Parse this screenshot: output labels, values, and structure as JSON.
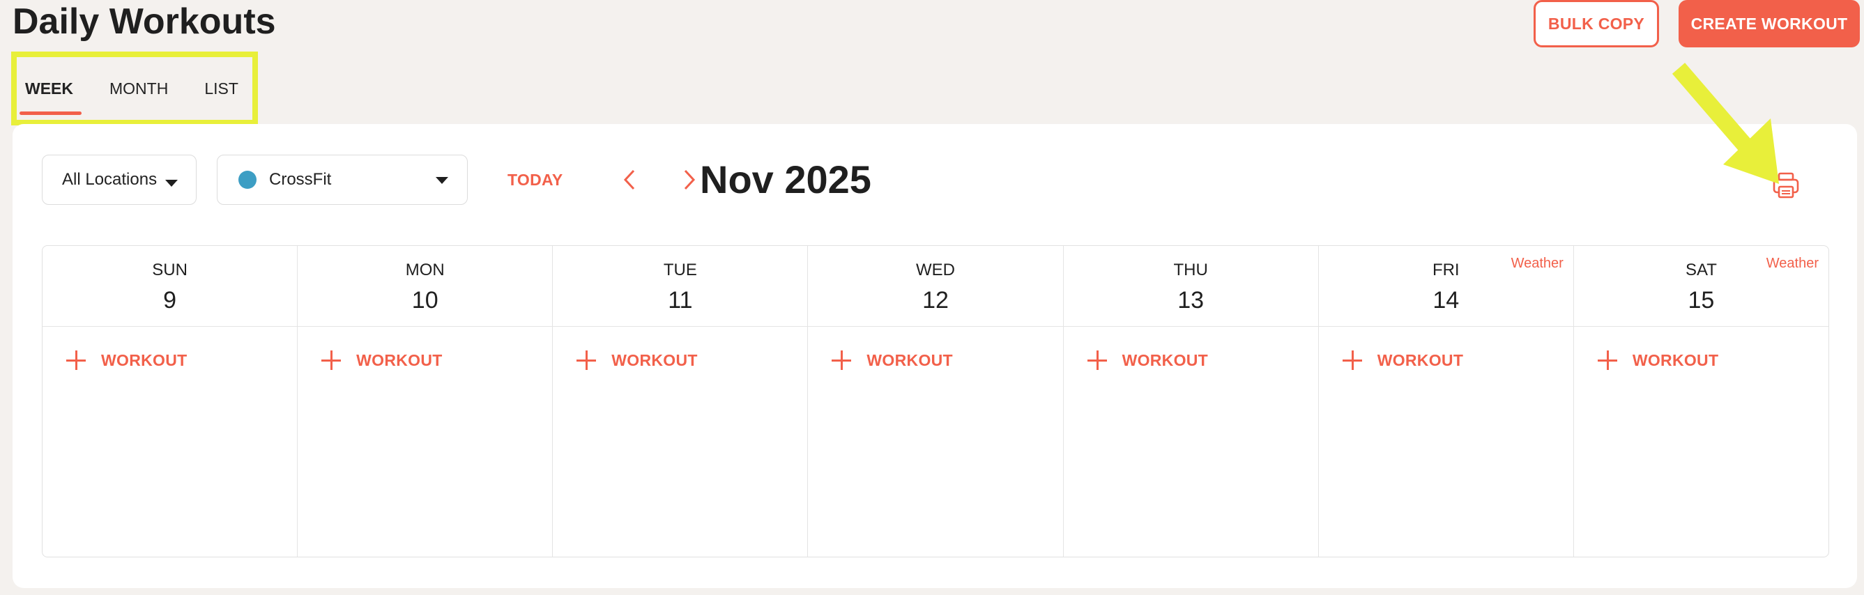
{
  "page": {
    "title": "Daily Workouts"
  },
  "header": {
    "bulk_copy_label": "BULK COPY",
    "create_workout_label": "CREATE WORKOUT"
  },
  "tabs": [
    {
      "label": "WEEK",
      "active": true
    },
    {
      "label": "MONTH",
      "active": false
    },
    {
      "label": "LIST",
      "active": false
    }
  ],
  "toolbar": {
    "location_select": "All Locations",
    "program_select": "CrossFit",
    "program_color": "#3d9ec4",
    "today_label": "TODAY",
    "prev_icon": "chevron-left-icon",
    "next_icon": "chevron-right-icon",
    "month_label": "Nov 2025",
    "print_icon": "printer-icon"
  },
  "calendar": {
    "days": [
      {
        "dow": "SUN",
        "date": "9",
        "weather": "",
        "add_label": "WORKOUT"
      },
      {
        "dow": "MON",
        "date": "10",
        "weather": "",
        "add_label": "WORKOUT"
      },
      {
        "dow": "TUE",
        "date": "11",
        "weather": "",
        "add_label": "WORKOUT"
      },
      {
        "dow": "WED",
        "date": "12",
        "weather": "",
        "add_label": "WORKOUT"
      },
      {
        "dow": "THU",
        "date": "13",
        "weather": "",
        "add_label": "WORKOUT"
      },
      {
        "dow": "FRI",
        "date": "14",
        "weather": "Weather",
        "add_label": "WORKOUT"
      },
      {
        "dow": "SAT",
        "date": "15",
        "weather": "Weather",
        "add_label": "WORKOUT"
      }
    ]
  },
  "colors": {
    "accent": "#f2604a",
    "highlight": "#e8ef3a",
    "background": "#f4f1ee"
  }
}
